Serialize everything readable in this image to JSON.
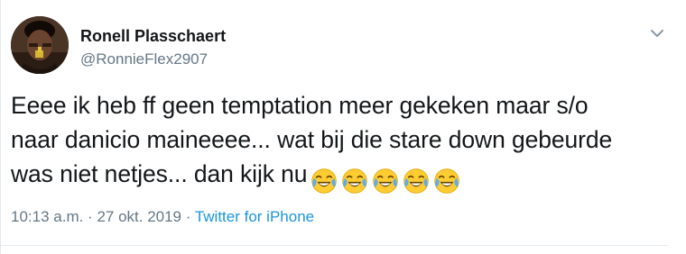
{
  "author": {
    "name": "Ronell Plasschaert",
    "handle": "@RonnieFlex2907"
  },
  "tweet": {
    "text": "Eeee ik heb ff geen temptation meer gekeken maar s/o\nnaar danicio maineeee... wat bij die stare down gebeurde\nwas niet netjes... dan kijk nu",
    "emojis": [
      "face-with-tears-of-joy-icon",
      "face-with-tears-of-joy-icon",
      "face-with-tears-of-joy-icon",
      "face-with-tears-of-joy-icon",
      "face-with-tears-of-joy-icon"
    ]
  },
  "meta": {
    "time": "10:13 a.m.",
    "sep1": " · ",
    "date": "27 okt. 2019",
    "sep2": " · ",
    "source": "Twitter for iPhone"
  },
  "colors": {
    "text": "#14171a",
    "secondary": "#657786",
    "link": "#1b95e0",
    "divider": "#e6ecf0"
  }
}
